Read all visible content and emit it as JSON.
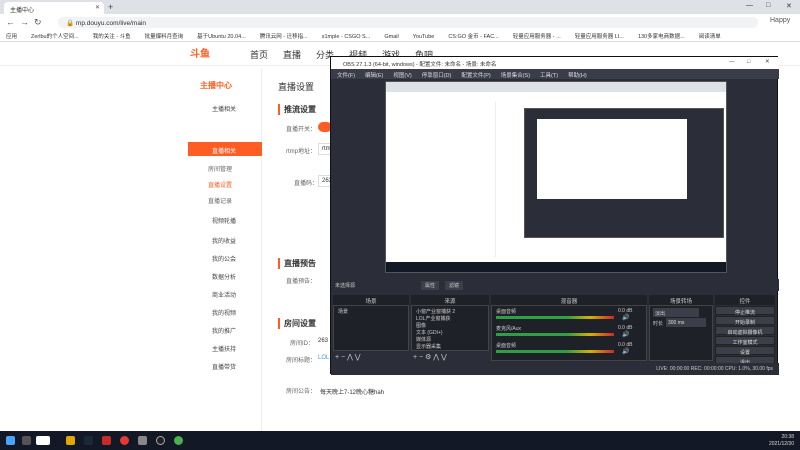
{
  "browser": {
    "tab_title": "主播中心",
    "url": "mp.douyu.com/live/main",
    "bookmarks": [
      "应用",
      "Zerlbu的个人空间...",
      "我的关注 - 斗鱼",
      "批量爆料月查询",
      "基于Ubuntu 20.04...",
      "腾讯云网 - 迁移指...",
      "s1mple - CSGO S...",
      "Gmail",
      "YouTube",
      "CS:GO 金币 - FAC...",
      "轻量应用服务器 - ...",
      "轻量应用服务器 LI...",
      "130多家电商数据...",
      "阅读清单"
    ],
    "user_label": "Happy"
  },
  "site": {
    "logo_text": "斗鱼",
    "nav": [
      "首页",
      "直播",
      "分类",
      "视频",
      "游戏",
      "鱼吧"
    ],
    "sidebar_title": "主播中心",
    "sidebar": [
      {
        "label": "主播相关",
        "type": "group"
      },
      {
        "label": "直播相关",
        "type": "active"
      },
      {
        "label": "房间管理",
        "type": "sub"
      },
      {
        "label": "直播设置",
        "type": "current"
      },
      {
        "label": "直播记录",
        "type": "sub"
      },
      {
        "label": "视频轮播",
        "type": "group"
      },
      {
        "label": "我的收益",
        "type": "group"
      },
      {
        "label": "我的公会",
        "type": "group"
      },
      {
        "label": "数据分析",
        "type": "group"
      },
      {
        "label": "商业活动",
        "type": "group"
      },
      {
        "label": "我的视频",
        "type": "group"
      },
      {
        "label": "我的推广",
        "type": "group"
      },
      {
        "label": "主播扶持",
        "type": "group"
      },
      {
        "label": "直播带货",
        "type": "group"
      }
    ],
    "page_title": "直播设置",
    "section_push": "推流设置",
    "push_switch_label": "直播开关：",
    "rtmp_label": "rtmp地址：",
    "rtmp_value": "rtm",
    "code_label": "直播码：",
    "code_value": "263",
    "section_preview": "直播预告",
    "preview_label": "直播预告：",
    "section_room": "房间设置",
    "room_id_label": "房间ID：",
    "room_id_value": "263",
    "room_title_label": "房间标题：",
    "room_title_value": "LOL",
    "room_notice_label": "房间公告：",
    "room_notice_value": "每天晚上7-12晚心糖hah"
  },
  "obs": {
    "title": "OBS 27.1.3 (64-bit, windows) - 配置文件: 未命名 - 场景: 未命名",
    "menu": [
      "文件(F)",
      "编辑(E)",
      "视图(V)",
      "停靠窗口(D)",
      "配置文件(P)",
      "场景集合(S)",
      "工具(T)",
      "帮助(H)"
    ],
    "source_bar_label": "未选择源",
    "properties_btn": "属性",
    "filters_btn": "滤镜",
    "docks": {
      "scenes": "场景",
      "sources": "来源",
      "mixer": "混音器",
      "transitions": "场景转场",
      "controls": "控件"
    },
    "scene_item": "场景",
    "sources": [
      "小窗产业窗捕获 2",
      "LOL产业窗捕获",
      "图像",
      "文本 (GDI+)",
      "媒体源",
      "显示器采集"
    ],
    "mixer": [
      {
        "name": "桌面音频",
        "db": "0.0 dB"
      },
      {
        "name": "麦克风/Aux",
        "db": "0.0 dB"
      },
      {
        "name": "桌面音频",
        "db": "0.0 dB"
      }
    ],
    "transition_value": "淡出",
    "duration_label": "时长",
    "duration_value": "300 ms",
    "controls": [
      "停止推流",
      "开始录制",
      "启动虚拟摄像机",
      "工作室模式",
      "设置",
      "退出"
    ],
    "status": "LIVE: 00:00:00   REC: 00:00:00   CPU: 1.0%, 30.00 fps"
  },
  "taskbar": {
    "time": "20:38",
    "date": "2021/12/30"
  },
  "colors": {
    "brand": "#ff5d23",
    "obs_bg": "#2b2e38"
  }
}
